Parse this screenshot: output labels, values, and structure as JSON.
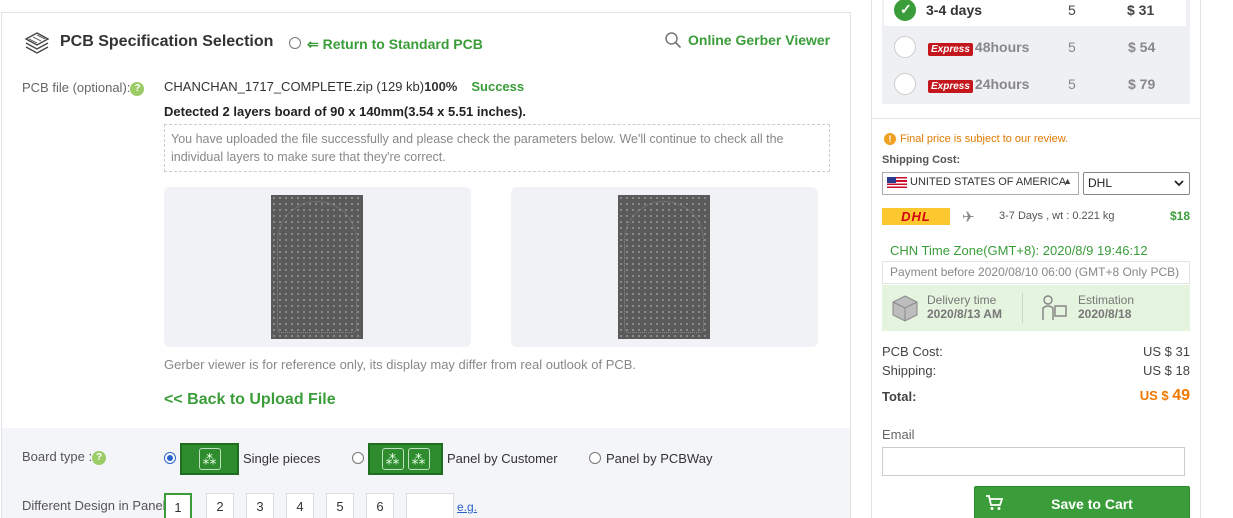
{
  "spec": {
    "title": "PCB Specification Selection",
    "return_link": "⇐ Return to Standard PCB",
    "gerber_viewer_link": "Online Gerber Viewer"
  },
  "upload": {
    "label": "PCB file (optional):",
    "file_name": "CHANCHAN_1717_COMPLETE.zip (129 kb)",
    "progress": "100%",
    "status": "Success",
    "detected": "Detected 2 layers board of 90 x 140mm(3.54 x 5.51 inches).",
    "notice": "You have uploaded the file successfully and please check the parameters below. We'll continue to check all the individual layers to make sure that they're correct.",
    "reference_note": "Gerber viewer is for reference only, its display may differ from real outlook of PCB.",
    "back_link": "<< Back to Upload File"
  },
  "board_type": {
    "label": "Board type :",
    "options": [
      {
        "label": "Single pieces",
        "selected": true
      },
      {
        "label": "Panel by Customer",
        "selected": false
      },
      {
        "label": "Panel by PCBWay",
        "selected": false
      }
    ]
  },
  "different_design": {
    "label": "Different Design in Panel",
    "options": [
      "1",
      "2",
      "3",
      "4",
      "5",
      "6"
    ],
    "selected": "1",
    "eg_link": "e.g."
  },
  "delivery": {
    "rows": [
      {
        "express": "",
        "label": "3-4 days",
        "qty": "5",
        "price": "$ 31",
        "selected": true
      },
      {
        "express": "Express",
        "label": "48hours",
        "qty": "5",
        "price": "$ 54",
        "selected": false
      },
      {
        "express": "Express",
        "label": "24hours",
        "qty": "5",
        "price": "$ 79",
        "selected": false
      }
    ]
  },
  "shipping": {
    "final_note": "Final price is subject to our review.",
    "label": "Shipping Cost:",
    "country": "UNITED STATES OF AMERICA",
    "carrier": "DHL",
    "carrier_logo": "DHL",
    "days": "3-7 Days ,   wt : 0.221 kg",
    "price": "$18"
  },
  "timing": {
    "timezone": "CHN Time Zone(GMT+8): 2020/8/9 19:46:12",
    "pay_before": "Payment before 2020/08/10 06:00 (GMT+8 Only PCB)",
    "delivery_time_label": "Delivery time",
    "delivery_time_value": "2020/8/13 AM",
    "estimation_label": "Estimation",
    "estimation_value": "2020/8/18"
  },
  "costs": {
    "pcb_label": "PCB Cost:",
    "pcb_value": "US $ 31",
    "shipping_label": "Shipping:",
    "shipping_value": "US $ 18",
    "total_label": "Total:",
    "total_prefix": "US $ ",
    "total_value": "49"
  },
  "email": {
    "label": "Email",
    "value": ""
  },
  "cart": {
    "button_label": "Save to Cart"
  },
  "colors": {
    "accent_green": "#3a9d3a",
    "express_red": "#c4171d",
    "total_orange": "#f07800"
  }
}
